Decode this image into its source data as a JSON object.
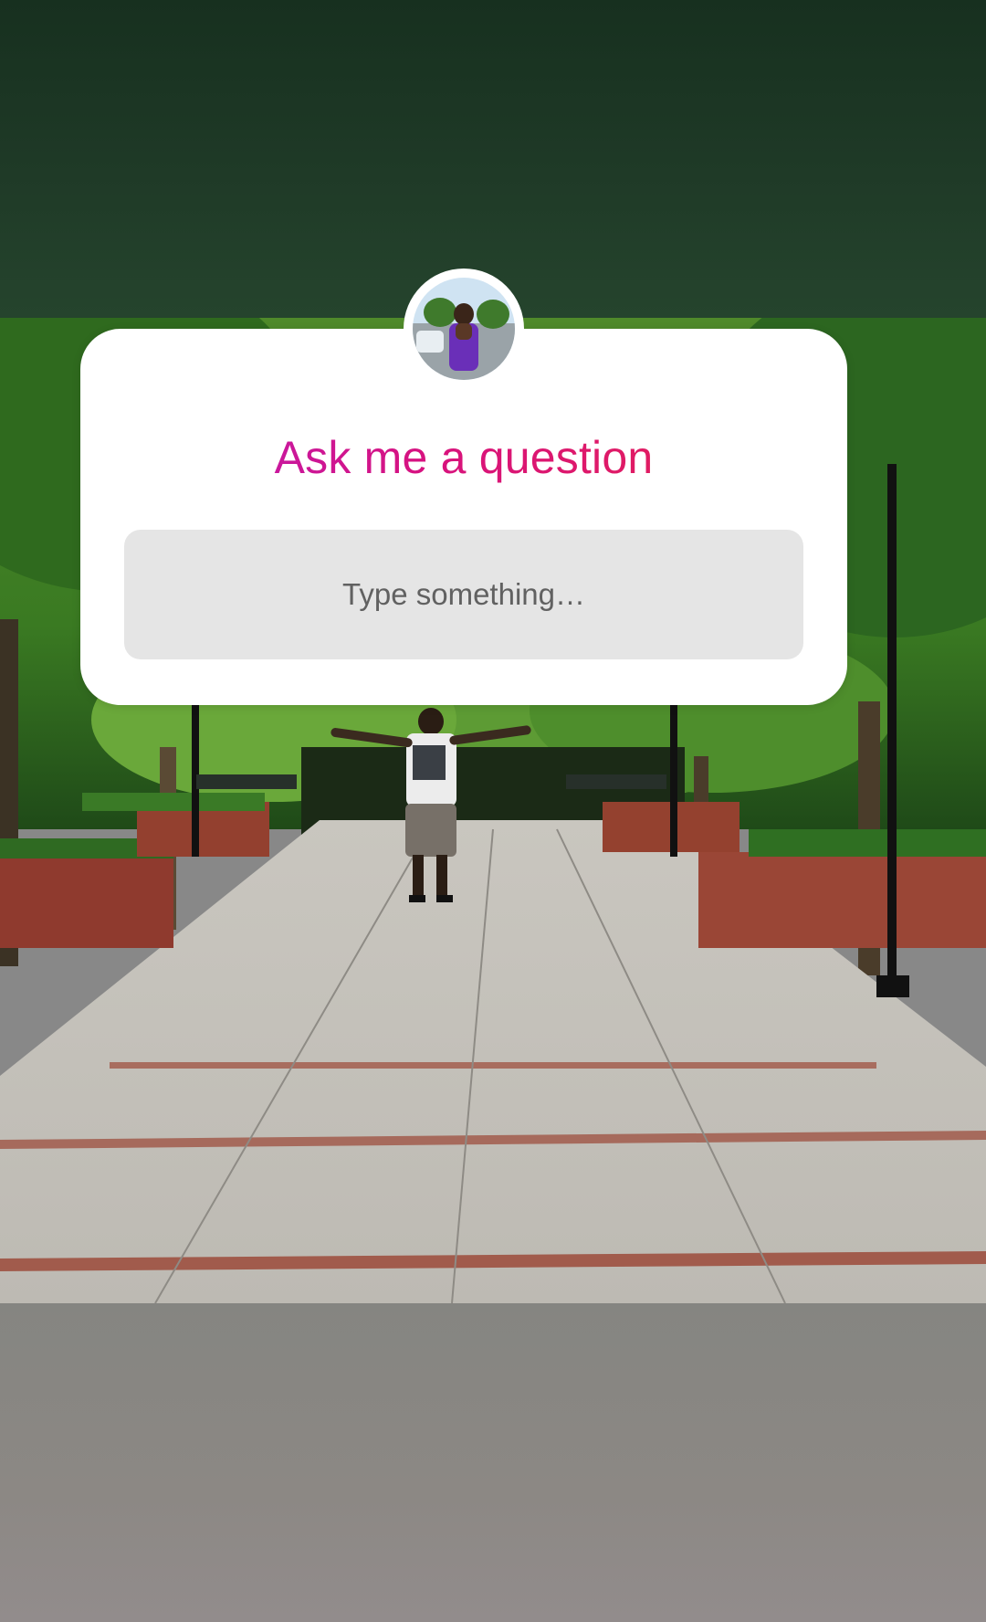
{
  "story": {
    "question_sticker": {
      "title": "Ask me a question",
      "input_placeholder": "Type something…"
    },
    "avatar_icon": "profile-avatar",
    "colors": {
      "title_gradient_start": "#b81fc2",
      "title_gradient_end": "#e8234a",
      "card_background": "#ffffff",
      "input_background": "#e5e5e5",
      "top_band": "#1f3a27",
      "bottom_band": "#8c8884"
    }
  }
}
